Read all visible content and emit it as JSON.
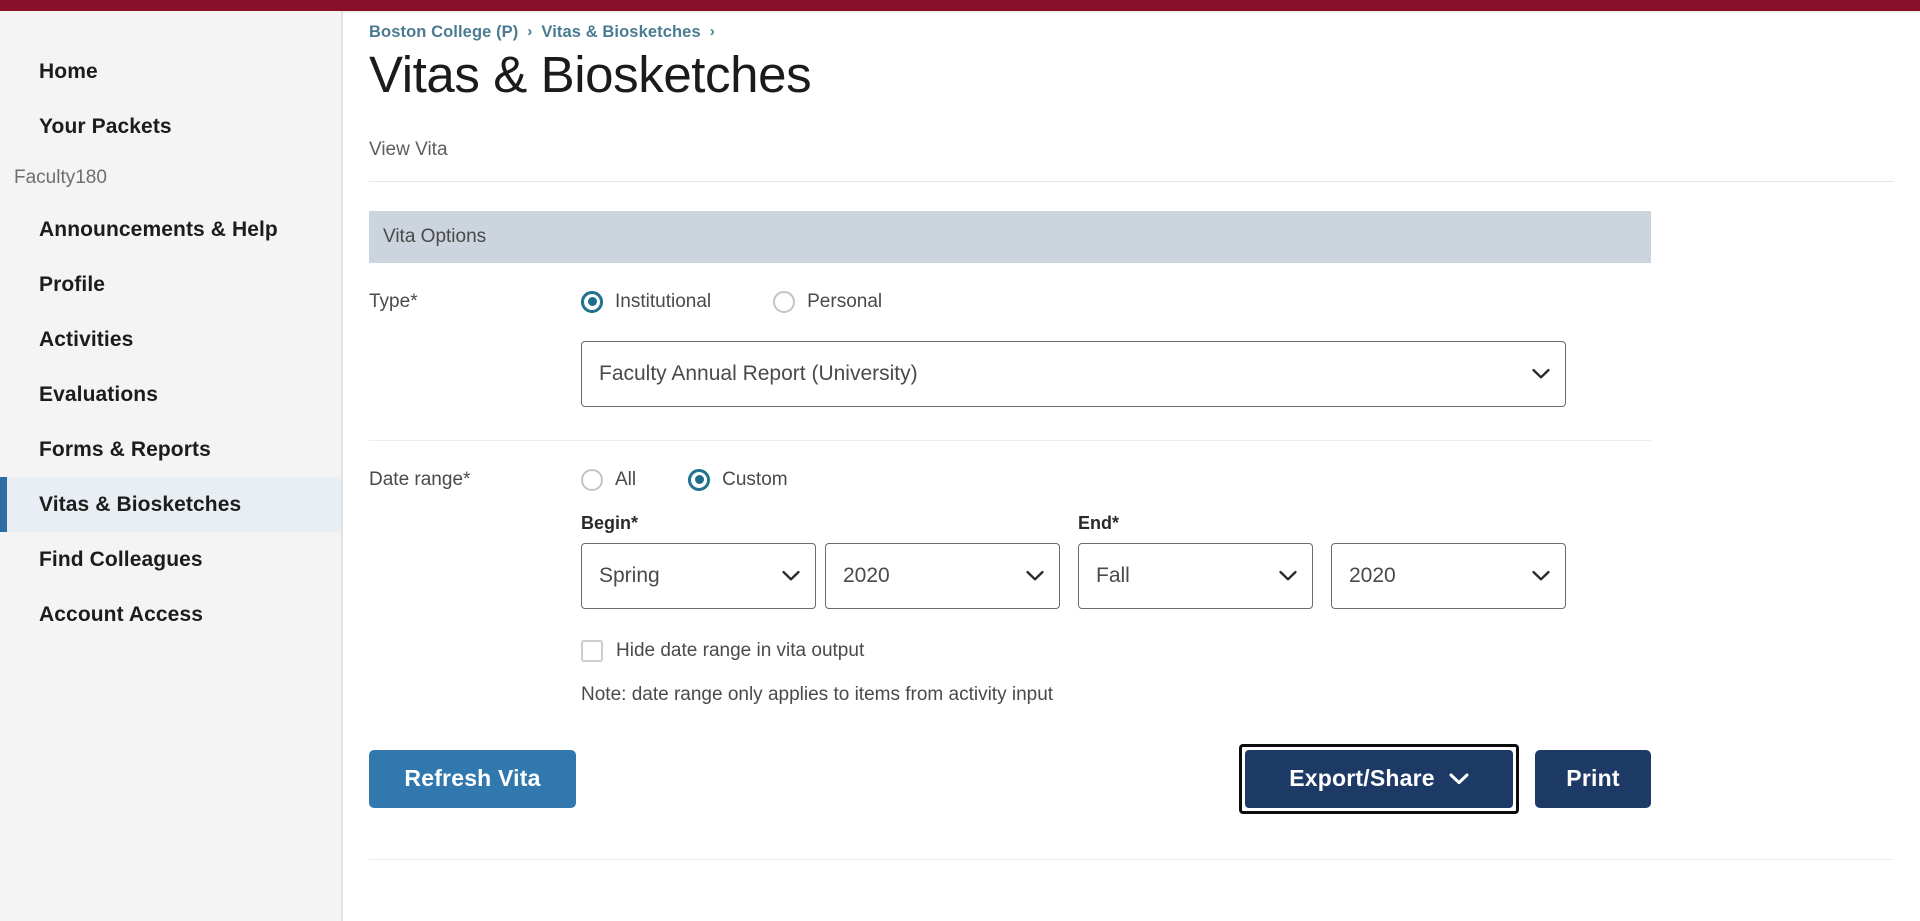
{
  "theme": {
    "top_bar_color": "#8a0f28",
    "sidebar_bg": "#f4f4f4",
    "active_indicator_color": "#2e6da4",
    "breadcrumb_link_color": "#4a7b91",
    "section_header_bg": "#ccd4dd",
    "radio_checked_color": "#1c6e8c",
    "refresh_button_color": "#3178ae",
    "primary_button_color": "#1d3a66",
    "focus_ring_color": "#0c0c0c"
  },
  "sidebar": {
    "items": [
      {
        "label": "Home",
        "type": "link",
        "active": false
      },
      {
        "label": "Your Packets",
        "type": "link",
        "active": false
      },
      {
        "label": "Faculty180",
        "type": "section",
        "active": false
      },
      {
        "label": "Announcements & Help",
        "type": "link",
        "active": false
      },
      {
        "label": "Profile",
        "type": "link",
        "active": false
      },
      {
        "label": "Activities",
        "type": "link",
        "active": false
      },
      {
        "label": "Evaluations",
        "type": "link",
        "active": false
      },
      {
        "label": "Forms & Reports",
        "type": "link",
        "active": false
      },
      {
        "label": "Vitas & Biosketches",
        "type": "link",
        "active": true
      },
      {
        "label": "Find Colleagues",
        "type": "link",
        "active": false
      },
      {
        "label": "Account Access",
        "type": "link",
        "active": false
      }
    ]
  },
  "breadcrumb": {
    "items": [
      {
        "label": "Boston College (P)"
      },
      {
        "label": "Vitas & Biosketches"
      }
    ],
    "separator": "›"
  },
  "header": {
    "title": "Vitas & Biosketches",
    "subtitle": "View Vita"
  },
  "vita_options": {
    "section_title": "Vita Options",
    "type": {
      "label": "Type*",
      "options": [
        {
          "label": "Institutional",
          "selected": true
        },
        {
          "label": "Personal",
          "selected": false
        }
      ],
      "select": {
        "value": "Faculty Annual Report (University)",
        "icon": "chevron-down-icon"
      }
    },
    "date_range": {
      "label": "Date range*",
      "options": [
        {
          "label": "All",
          "selected": false
        },
        {
          "label": "Custom",
          "selected": true
        }
      ],
      "begin_label": "Begin*",
      "end_label": "End*",
      "selects": [
        {
          "name": "begin-term",
          "value": "Spring"
        },
        {
          "name": "begin-year",
          "value": "2020"
        },
        {
          "name": "end-term",
          "value": "Fall"
        },
        {
          "name": "end-year",
          "value": "2020"
        }
      ],
      "hide_checkbox": {
        "label": "Hide date range in vita output",
        "checked": false
      },
      "note": "Note: date range only applies to items from activity input"
    }
  },
  "actions": {
    "refresh_label": "Refresh Vita",
    "export_label": "Export/Share",
    "export_icon": "chevron-down-icon",
    "print_label": "Print",
    "export_focused": true
  }
}
